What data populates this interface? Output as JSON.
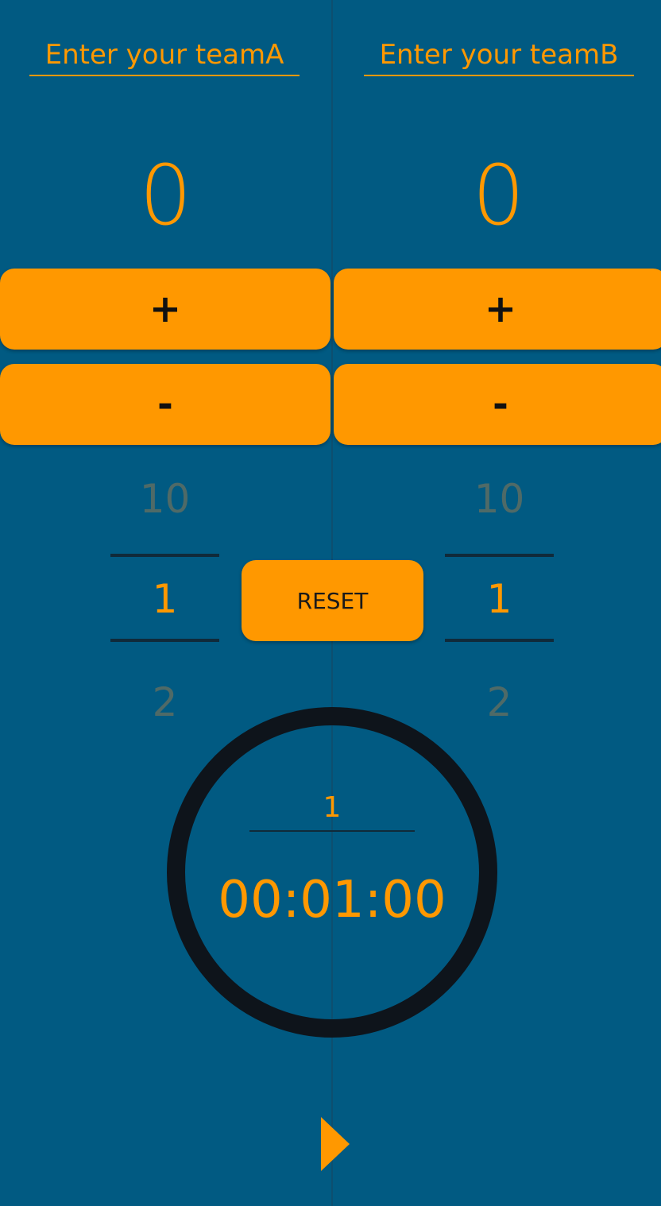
{
  "colors": {
    "background": "#015A82",
    "accent": "#FF9800",
    "dark": "#0E141B",
    "muted": "#4F6A67"
  },
  "teamA": {
    "placeholder": "Enter your teamA",
    "score": "0",
    "plus_label": "+",
    "minus_label": "-",
    "picker": {
      "prev": "10",
      "selected": "1",
      "next": "2"
    }
  },
  "teamB": {
    "placeholder": "Enter your teamB",
    "score": "0",
    "plus_label": "+",
    "minus_label": "-",
    "picker": {
      "prev": "10",
      "selected": "1",
      "next": "2"
    }
  },
  "reset_label": "RESET",
  "timer": {
    "minute_value": "1",
    "display": "00:01:00"
  },
  "icons": {
    "play": "play-icon"
  }
}
